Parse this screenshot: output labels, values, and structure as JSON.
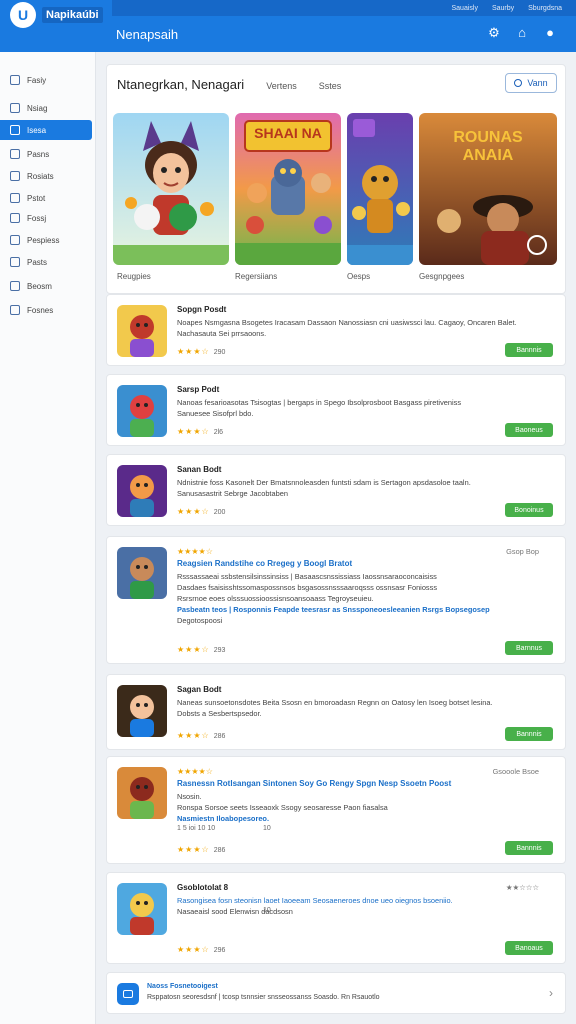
{
  "topbar": {
    "links": [
      "Sauaisly",
      "Saurby",
      "Sburgdsna"
    ]
  },
  "header": {
    "logo_letter": "U",
    "logo_text": "Napikaúbi",
    "title": "Nenapsaih",
    "icons": [
      "settings-icon",
      "home-icon",
      "user-icon"
    ]
  },
  "sidebar": {
    "items": [
      {
        "label": "Fasiy",
        "icon": "home-icon",
        "active": false
      },
      {
        "label": "Nsiag",
        "icon": "calendar-icon",
        "active": false
      },
      {
        "label": "Isesa",
        "icon": "grid-icon",
        "active": true
      },
      {
        "label": "Pasns",
        "icon": "mail-icon",
        "active": false
      },
      {
        "label": "Rosiats",
        "icon": "lock-icon",
        "active": false
      },
      {
        "label": "Pstot",
        "icon": "doc-icon",
        "active": false
      },
      {
        "label": "Fossj",
        "icon": "clock-icon",
        "active": false
      },
      {
        "label": "Pespiess",
        "icon": "chart-icon",
        "active": false
      },
      {
        "label": "Pasts",
        "icon": "trend-icon",
        "active": false
      },
      {
        "label": "Beosm",
        "icon": "refresh-icon",
        "active": false
      },
      {
        "label": "Fosnes",
        "icon": "box-icon",
        "active": false
      }
    ]
  },
  "panel": {
    "tabs": [
      "Ntanegrkan, Nenagari",
      "Vertens",
      "Sstes"
    ],
    "view_label": "Vann",
    "featured": [
      {
        "label": "Reugpies",
        "title_art": ""
      },
      {
        "label": "Regersiians",
        "title_art": "SHAAI NA"
      },
      {
        "label": "Oesps",
        "title_art": ""
      },
      {
        "label": "Gesgnpgees",
        "title_art": "ROUNAS ANAIA"
      }
    ]
  },
  "games": [
    {
      "title": "Sopgn Posdt",
      "lines": [
        {
          "text": "Noapes Nsmgasna Bsogetes Iracasam Dassaon Nanossiasn cni uasiwssci lau. Cagaoy, Oncaren Balet.",
          "style": "normal"
        },
        {
          "text": "Nachasauta Sei prrsaoons.",
          "style": "normal"
        }
      ],
      "stars": "★★★☆",
      "rating_count": "290",
      "button": "Bannnis",
      "rating_text": ""
    },
    {
      "title": "Sarsp Podt",
      "lines": [
        {
          "text": "Nanoas fesarioasotas Tsisogtas | bergaps in Spego Ibsolprosboot Basgass piretiveniss",
          "style": "normal"
        },
        {
          "text": "Sanuesee Sisofprl bdo.",
          "style": "normal"
        }
      ],
      "stars": "★★★☆",
      "rating_count": "2l6",
      "button": "Baoneus",
      "rating_text": ""
    },
    {
      "title": "Sanan Bodt",
      "lines": [
        {
          "text": "Ndnistnie foss Kasonelt Der Bmatsnnoleasden funtsti sdam is Sertagon apsdasoloe taaln.",
          "style": "normal"
        },
        {
          "text": "Sanusasastrit Sebrge Jacobtaben",
          "style": "normal"
        }
      ],
      "stars": "★★★☆",
      "rating_count": "200",
      "button": "Bonoinus",
      "rating_text": ""
    },
    {
      "title": "Reagsien Randstihe co Rregeg y Boogl Bratot",
      "lines": [
        {
          "text": "Rsssassaeai ssbstensilsinssinsiss | Basaascsnssissiass Iaossnsaraoconcaisiss",
          "style": "normal"
        },
        {
          "text": "Dasdaes fsaisisshtssomaspossnsos bsgasossnsssaaroqsss ossnsasr Foniosss",
          "style": "normal"
        },
        {
          "text": "Rsrsrnoe eoes olsssuossioossisnsoansoaass Tegroyseuieu.",
          "style": "normal"
        },
        {
          "text": "Pasbeatn teos | Rosponnis Feapde teesrasr as Snssponeoesleeanien Rsrgs Bopsegosep",
          "style": "blue"
        },
        {
          "text": "Degotospoosi",
          "style": "normal"
        }
      ],
      "stars": "★★★☆",
      "rating_count": "293",
      "button": "Barnnus",
      "rating_text": "Gsop Bop",
      "top_stars": "★★★★☆"
    },
    {
      "title": "Sagan Bodt",
      "lines": [
        {
          "text": "Naneas sunsoetonsdotes Beita Ssosn en bmoroadasn Regnn on Oatosy len Isoeg botset lesina.",
          "style": "normal"
        },
        {
          "text": "Dobsts a Sesbertspsedor.",
          "style": "normal"
        }
      ],
      "stars": "★★★☆",
      "rating_count": "286",
      "button": "Bannnis",
      "rating_text": ""
    },
    {
      "title": "Rasnessn Rotlsangan Sintonen Soy Go Rengy Spgn Nesp Ssoetn Poost",
      "lines": [
        {
          "text": "Nsosin.",
          "style": "normal"
        },
        {
          "text": "Ronspa Sorsoe seets Isseaoxk Ssogy seosaresse Paon fiasalsa",
          "style": "normal"
        },
        {
          "text": "Nasmiestn Iloabopesoreo.",
          "style": "blue"
        }
      ],
      "meta_left": "1 5 ioi 10 10",
      "meta_right": "10",
      "stars": "★★★☆",
      "rating_count": "286",
      "button": "Bannnis",
      "rating_text": "Gsooole Bsoe",
      "top_stars": "★★★★☆"
    },
    {
      "title": "Gsoblotolat 8",
      "lines": [
        {
          "text": "Rasongisea fosn steonisn laoet Iaoeeam Seosaeneroes dnoe ueo oiegnos bsoeniio.",
          "style": "blue-partial"
        },
        {
          "text": "Nasaeaisl sood Elenwisn dacdsosn",
          "style": "normal"
        }
      ],
      "meta_right": "10",
      "stars": "★★★☆",
      "rating_count": "296",
      "button": "Banoaus",
      "rating_text": "★★☆☆☆"
    }
  ],
  "footer": {
    "title": "Naoss Fosnetooigest",
    "text": "Rsppatosn seoresdsnf | tcosp tsnnsier snsseossanss Soasdo. Rn Rsauotlo",
    "chevron": "chevron-right-icon"
  }
}
